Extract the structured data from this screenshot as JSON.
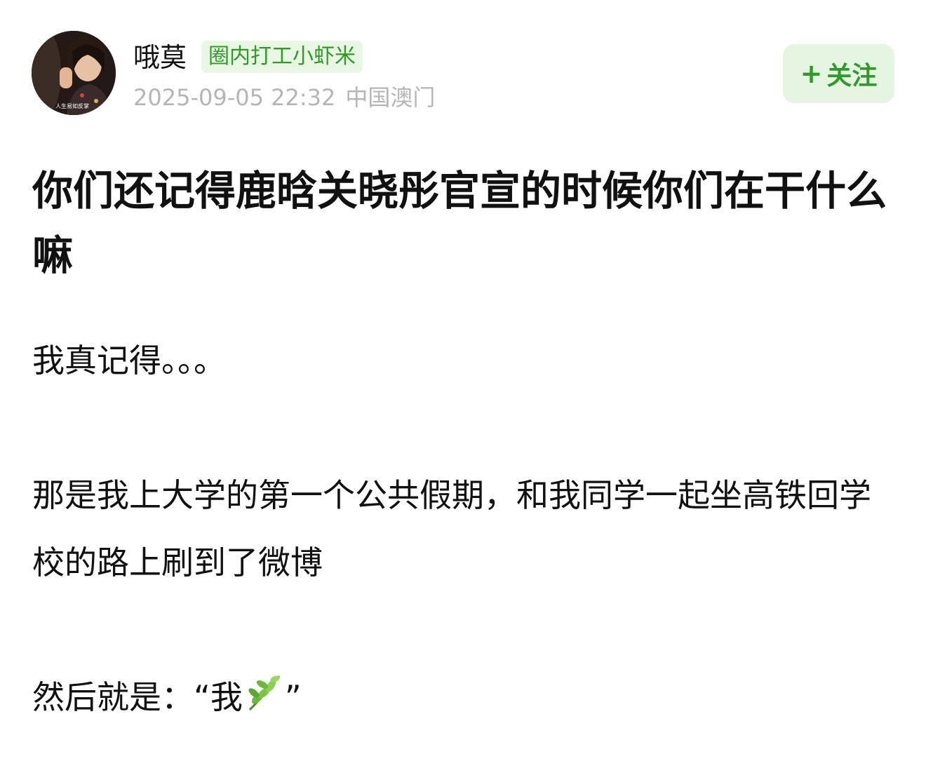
{
  "author": {
    "name": "哦莫",
    "badge": "圈内打工小虾米",
    "avatar_caption": "人生易如反掌",
    "timestamp": "2025-09-05 22:32",
    "location": "中国澳门"
  },
  "follow_button": {
    "plus": "+",
    "label": "关注"
  },
  "post": {
    "title": "你们还记得鹿晗关晓彤官宣的时候你们在干什么嘛",
    "paragraphs": [
      "我真记得。。。",
      "那是我上大学的第一个公共假期，和我同学一起坐高铁回学校的路上刷到了微博",
      "然后就是：“我"
    ],
    "closing_quote": "”",
    "emoji_icon": "herb-emoji-icon"
  },
  "colors": {
    "accent_green": "#2f9a2a",
    "badge_bg": "#e9f6e4",
    "button_bg": "#e6f5e1",
    "meta_gray": "#b5b5b5",
    "text": "#111111"
  }
}
